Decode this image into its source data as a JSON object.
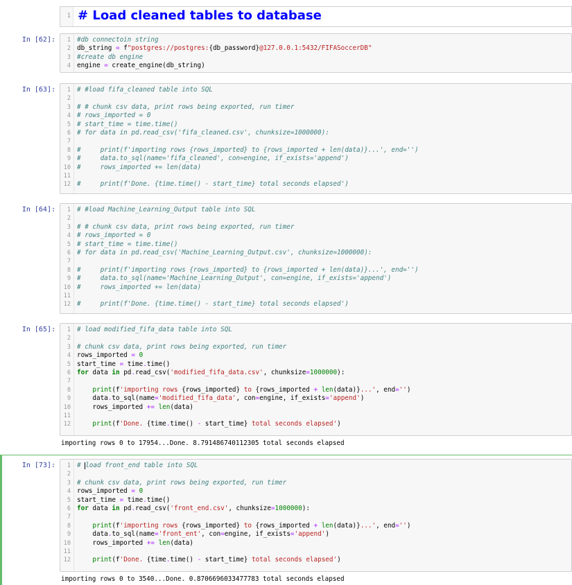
{
  "markdown_cell": {
    "line_number": "1",
    "text": "# Load cleaned tables to database"
  },
  "cells": [
    {
      "prompt": "In [62]:",
      "lines": [
        [
          [
            "cm",
            "#db connectoin string"
          ]
        ],
        [
          [
            "",
            "db_string "
          ],
          [
            "op",
            "="
          ],
          [
            "",
            " f"
          ],
          [
            "st",
            "\"postgres://postgres:"
          ],
          [
            "",
            "{db_password}"
          ],
          [
            "st",
            "@127.0.0.1:5432/FIFASoccerDB\""
          ]
        ],
        [
          [
            "cm",
            "#create db engine"
          ]
        ],
        [
          [
            "",
            "engine "
          ],
          [
            "op",
            "="
          ],
          [
            "",
            " create_engine(db_string)"
          ]
        ]
      ]
    },
    {
      "prompt": "In [63]:",
      "lines": [
        [
          [
            "cm",
            "# #load fifa_cleaned table into SQL"
          ]
        ],
        [],
        [
          [
            "cm",
            "# # chunk csv data, print rows being exported, run timer"
          ]
        ],
        [
          [
            "cm",
            "# rows_imported = 0"
          ]
        ],
        [
          [
            "cm",
            "# start_time = time.time()"
          ]
        ],
        [
          [
            "cm",
            "# for data in pd.read_csv('fifa_cleaned.csv', chunksize=1000000):"
          ]
        ],
        [],
        [
          [
            "cm",
            "#     print(f'importing rows {rows_imported} to {rows_imported + len(data)}...', end='')"
          ]
        ],
        [
          [
            "cm",
            "#     data.to_sql(name='fifa_cleaned', con=engine, if_exists='append')"
          ]
        ],
        [
          [
            "cm",
            "#     rows_imported += len(data)"
          ]
        ],
        [],
        [
          [
            "cm",
            "#     print(f'Done. {time.time() - start_time} total seconds elapsed')"
          ]
        ]
      ]
    },
    {
      "prompt": "In [64]:",
      "lines": [
        [
          [
            "cm",
            "# #load Machine_Learning_Output table into SQL"
          ]
        ],
        [],
        [
          [
            "cm",
            "# # chunk csv data, print rows being exported, run timer"
          ]
        ],
        [
          [
            "cm",
            "# rows_imported = 0"
          ]
        ],
        [
          [
            "cm",
            "# start_time = time.time()"
          ]
        ],
        [
          [
            "cm",
            "# for data in pd.read_csv('Machine_Learning_Output.csv', chunksize=1000000):"
          ]
        ],
        [],
        [
          [
            "cm",
            "#     print(f'importing rows {rows_imported} to {rows_imported + len(data)}...', end='')"
          ]
        ],
        [
          [
            "cm",
            "#     data.to_sql(name='Machine_Learning_Output', con=engine, if_exists='append')"
          ]
        ],
        [
          [
            "cm",
            "#     rows_imported += len(data)"
          ]
        ],
        [],
        [
          [
            "cm",
            "#     print(f'Done. {time.time() - start_time} total seconds elapsed')"
          ]
        ]
      ]
    },
    {
      "prompt": "In [65]:",
      "lines": [
        [
          [
            "cm",
            "# load modified_fifa_data table into SQL"
          ]
        ],
        [],
        [
          [
            "cm",
            "# chunk csv data, print rows being exported, run timer"
          ]
        ],
        [
          [
            "",
            "rows_imported "
          ],
          [
            "op",
            "="
          ],
          [
            "",
            " "
          ],
          [
            "num",
            "0"
          ]
        ],
        [
          [
            "",
            "start_time "
          ],
          [
            "op",
            "="
          ],
          [
            "",
            " time"
          ],
          [
            "op",
            "."
          ],
          [
            "",
            "time()"
          ]
        ],
        [
          [
            "kw",
            "for"
          ],
          [
            "",
            " data "
          ],
          [
            "kw",
            "in"
          ],
          [
            "",
            " pd"
          ],
          [
            "op",
            "."
          ],
          [
            "",
            "read_csv("
          ],
          [
            "st",
            "'modified_fifa_data.csv'"
          ],
          [
            "",
            ", chunksize"
          ],
          [
            "op",
            "="
          ],
          [
            "num",
            "1000000"
          ],
          [
            "",
            "):"
          ]
        ],
        [],
        [
          [
            "",
            "    "
          ],
          [
            "bi",
            "print"
          ],
          [
            "",
            "(f"
          ],
          [
            "st",
            "'importing rows "
          ],
          [
            "",
            "{rows_imported}"
          ],
          [
            "st",
            " to "
          ],
          [
            "",
            "{rows_imported "
          ],
          [
            "op",
            "+"
          ],
          [
            "",
            " "
          ],
          [
            "bi",
            "len"
          ],
          [
            "",
            "(data)}"
          ],
          [
            "st",
            "...'"
          ],
          [
            "",
            ", end"
          ],
          [
            "op",
            "="
          ],
          [
            "st",
            "''"
          ],
          [
            "",
            ")"
          ]
        ],
        [
          [
            "",
            "    data"
          ],
          [
            "op",
            "."
          ],
          [
            "",
            "to_sql(name"
          ],
          [
            "op",
            "="
          ],
          [
            "st",
            "'modified_fifa_data'"
          ],
          [
            "",
            ", con"
          ],
          [
            "op",
            "="
          ],
          [
            "",
            "engine, if_exists"
          ],
          [
            "op",
            "="
          ],
          [
            "st",
            "'append'"
          ],
          [
            "",
            ")"
          ]
        ],
        [
          [
            "",
            "    rows_imported "
          ],
          [
            "op",
            "+="
          ],
          [
            "",
            " "
          ],
          [
            "bi",
            "len"
          ],
          [
            "",
            "(data)"
          ]
        ],
        [],
        [
          [
            "",
            "    "
          ],
          [
            "bi",
            "print"
          ],
          [
            "",
            "(f"
          ],
          [
            "st",
            "'Done. "
          ],
          [
            "",
            "{time"
          ],
          [
            "op",
            "."
          ],
          [
            "",
            "time() "
          ],
          [
            "op",
            "-"
          ],
          [
            "",
            " start_time}"
          ],
          [
            "st",
            " total seconds elapsed'"
          ],
          [
            "",
            ")"
          ]
        ]
      ],
      "output": "importing rows 0 to 17954...Done. 8.791486740112305 total seconds elapsed"
    },
    {
      "prompt": "In [73]:",
      "lines": [
        [
          [
            "cm",
            "# "
          ],
          [
            "cursor",
            ""
          ],
          [
            "cm",
            "load front_end table into SQL"
          ]
        ],
        [],
        [
          [
            "cm",
            "# chunk csv data, print rows being exported, run timer"
          ]
        ],
        [
          [
            "",
            "rows_imported "
          ],
          [
            "op",
            "="
          ],
          [
            "",
            " "
          ],
          [
            "num",
            "0"
          ]
        ],
        [
          [
            "",
            "start_time "
          ],
          [
            "op",
            "="
          ],
          [
            "",
            " time"
          ],
          [
            "op",
            "."
          ],
          [
            "",
            "time()"
          ]
        ],
        [
          [
            "kw",
            "for"
          ],
          [
            "",
            " data "
          ],
          [
            "kw",
            "in"
          ],
          [
            "",
            " pd"
          ],
          [
            "op",
            "."
          ],
          [
            "",
            "read_csv("
          ],
          [
            "st",
            "'front_end.csv'"
          ],
          [
            "",
            ", chunksize"
          ],
          [
            "op",
            "="
          ],
          [
            "num",
            "1000000"
          ],
          [
            "",
            "):"
          ]
        ],
        [],
        [
          [
            "",
            "    "
          ],
          [
            "bi",
            "print"
          ],
          [
            "",
            "(f"
          ],
          [
            "st",
            "'importing rows "
          ],
          [
            "",
            "{rows_imported}"
          ],
          [
            "st",
            " to "
          ],
          [
            "",
            "{rows_imported "
          ],
          [
            "op",
            "+"
          ],
          [
            "",
            " "
          ],
          [
            "bi",
            "len"
          ],
          [
            "",
            "(data)}"
          ],
          [
            "st",
            "...'"
          ],
          [
            "",
            ", end"
          ],
          [
            "op",
            "="
          ],
          [
            "st",
            "''"
          ],
          [
            "",
            ")"
          ]
        ],
        [
          [
            "",
            "    data"
          ],
          [
            "op",
            "."
          ],
          [
            "",
            "to_sql(name"
          ],
          [
            "op",
            "="
          ],
          [
            "st",
            "'front_ent'"
          ],
          [
            "",
            ", con"
          ],
          [
            "op",
            "="
          ],
          [
            "",
            "engine, if_exists"
          ],
          [
            "op",
            "="
          ],
          [
            "st",
            "'append'"
          ],
          [
            "",
            ")"
          ]
        ],
        [
          [
            "",
            "    rows_imported "
          ],
          [
            "op",
            "+="
          ],
          [
            "",
            " "
          ],
          [
            "bi",
            "len"
          ],
          [
            "",
            "(data)"
          ]
        ],
        [],
        [
          [
            "",
            "    "
          ],
          [
            "bi",
            "print"
          ],
          [
            "",
            "(f"
          ],
          [
            "st",
            "'Done. "
          ],
          [
            "",
            "{time"
          ],
          [
            "op",
            "."
          ],
          [
            "",
            "time() "
          ],
          [
            "op",
            "-"
          ],
          [
            "",
            " start_time}"
          ],
          [
            "st",
            " total seconds elapsed'"
          ],
          [
            "",
            ")"
          ]
        ]
      ],
      "output": "importing rows 0 to 3540...Done. 0.8706696033477783 total seconds elapsed"
    }
  ]
}
